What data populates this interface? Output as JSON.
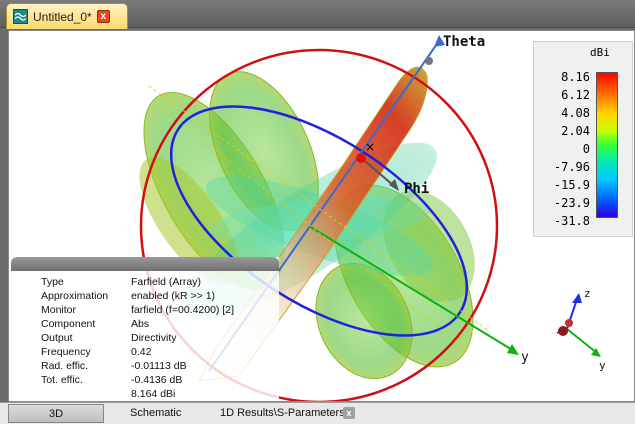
{
  "window": {
    "tab_title": "Untitled_0*",
    "tab_icon": "wave-app-icon",
    "close_glyph": "x"
  },
  "scene": {
    "axis_theta_label": "Theta",
    "axis_phi_label": "Phi",
    "axis_y_label": "y",
    "triad": {
      "z": "z",
      "y": "y"
    }
  },
  "legend": {
    "unit": "dBi",
    "ticks": [
      "8.16",
      "6.12",
      "4.08",
      "2.04",
      "0",
      "-7.96",
      "-15.9",
      "-23.9",
      "-31.8"
    ]
  },
  "info": {
    "rows": [
      {
        "label": "Type",
        "value": "Farfield (Array)"
      },
      {
        "label": "Approximation",
        "value": "enabled (kR >> 1)"
      },
      {
        "label": "Monitor",
        "value": "farfield (f=00.4200) [2]"
      },
      {
        "label": "Component",
        "value": "Abs"
      },
      {
        "label": "Output",
        "value": "Directivity"
      },
      {
        "label": "Frequency",
        "value": "0.42"
      },
      {
        "label": "Rad. effic.",
        "value": "-0.01113 dB"
      },
      {
        "label": "Tot. effic.",
        "value": "-0.4136 dB"
      },
      {
        "label": "",
        "value": "8.164 dBi"
      }
    ]
  },
  "bottom_tabs": {
    "tab_3d": "3D",
    "tab_schematic": "Schematic",
    "tab_1d": "1D Results\\S-Parameters",
    "close_glyph": "x"
  },
  "colors": {
    "accent_tab": "#ffd86a",
    "ring_red": "#d01010",
    "ring_blue": "#2020e0",
    "axis_green": "#10b010"
  }
}
